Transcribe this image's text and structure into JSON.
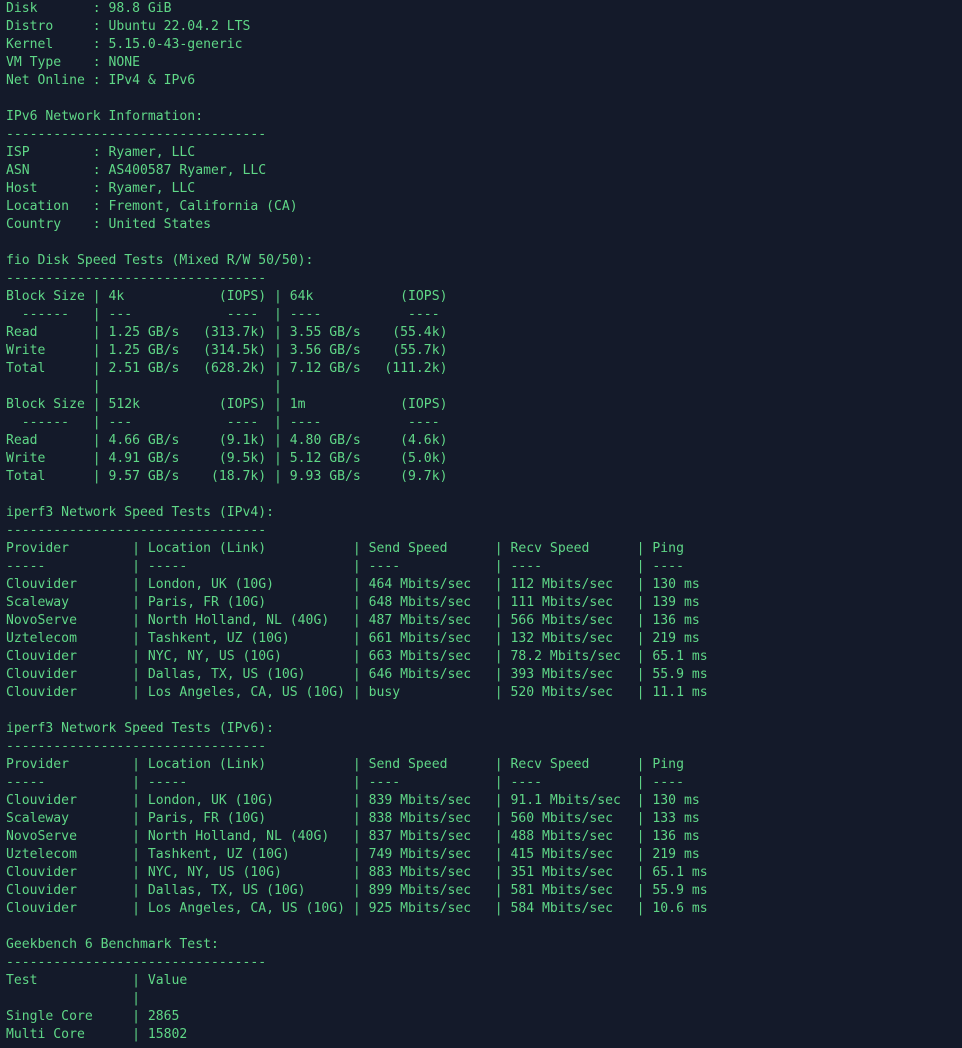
{
  "theme": {
    "background": "#141a2a",
    "text": "#5fd787"
  },
  "terminal": {
    "lines": [
      "Disk       : 98.8 GiB",
      "Distro     : Ubuntu 22.04.2 LTS",
      "Kernel     : 5.15.0-43-generic",
      "VM Type    : NONE",
      "Net Online : IPv4 & IPv6",
      "",
      "IPv6 Network Information:",
      "---------------------------------",
      "ISP        : Ryamer, LLC",
      "ASN        : AS400587 Ryamer, LLC",
      "Host       : Ryamer, LLC",
      "Location   : Fremont, California (CA)",
      "Country    : United States",
      "",
      "fio Disk Speed Tests (Mixed R/W 50/50):",
      "---------------------------------",
      "Block Size | 4k            (IOPS) | 64k           (IOPS)",
      "  ------   | ---            ----  | ----           ----",
      "Read       | 1.25 GB/s   (313.7k) | 3.55 GB/s    (55.4k)",
      "Write      | 1.25 GB/s   (314.5k) | 3.56 GB/s    (55.7k)",
      "Total      | 2.51 GB/s   (628.2k) | 7.12 GB/s   (111.2k)",
      "           |                      |",
      "Block Size | 512k          (IOPS) | 1m            (IOPS)",
      "  ------   | ---            ----  | ----           ----",
      "Read       | 4.66 GB/s     (9.1k) | 4.80 GB/s     (4.6k)",
      "Write      | 4.91 GB/s     (9.5k) | 5.12 GB/s     (5.0k)",
      "Total      | 9.57 GB/s    (18.7k) | 9.93 GB/s     (9.7k)",
      "",
      "iperf3 Network Speed Tests (IPv4):",
      "---------------------------------",
      "Provider        | Location (Link)           | Send Speed      | Recv Speed      | Ping",
      "-----           | -----                     | ----            | ----            | ----",
      "Clouvider       | London, UK (10G)          | 464 Mbits/sec   | 112 Mbits/sec   | 130 ms",
      "Scaleway        | Paris, FR (10G)           | 648 Mbits/sec   | 111 Mbits/sec   | 139 ms",
      "NovoServe       | North Holland, NL (40G)   | 487 Mbits/sec   | 566 Mbits/sec   | 136 ms",
      "Uztelecom       | Tashkent, UZ (10G)        | 661 Mbits/sec   | 132 Mbits/sec   | 219 ms",
      "Clouvider       | NYC, NY, US (10G)         | 663 Mbits/sec   | 78.2 Mbits/sec  | 65.1 ms",
      "Clouvider       | Dallas, TX, US (10G)      | 646 Mbits/sec   | 393 Mbits/sec   | 55.9 ms",
      "Clouvider       | Los Angeles, CA, US (10G) | busy            | 520 Mbits/sec   | 11.1 ms",
      "",
      "iperf3 Network Speed Tests (IPv6):",
      "---------------------------------",
      "Provider        | Location (Link)           | Send Speed      | Recv Speed      | Ping",
      "-----           | -----                     | ----            | ----            | ----",
      "Clouvider       | London, UK (10G)          | 839 Mbits/sec   | 91.1 Mbits/sec  | 130 ms",
      "Scaleway        | Paris, FR (10G)           | 838 Mbits/sec   | 560 Mbits/sec   | 133 ms",
      "NovoServe       | North Holland, NL (40G)   | 837 Mbits/sec   | 488 Mbits/sec   | 136 ms",
      "Uztelecom       | Tashkent, UZ (10G)        | 749 Mbits/sec   | 415 Mbits/sec   | 219 ms",
      "Clouvider       | NYC, NY, US (10G)         | 883 Mbits/sec   | 351 Mbits/sec   | 65.1 ms",
      "Clouvider       | Dallas, TX, US (10G)      | 899 Mbits/sec   | 581 Mbits/sec   | 55.9 ms",
      "Clouvider       | Los Angeles, CA, US (10G) | 925 Mbits/sec   | 584 Mbits/sec   | 10.6 ms",
      "",
      "Geekbench 6 Benchmark Test:",
      "---------------------------------",
      "Test            | Value",
      "                |",
      "Single Core     | 2865",
      "Multi Core      | 15802"
    ]
  }
}
